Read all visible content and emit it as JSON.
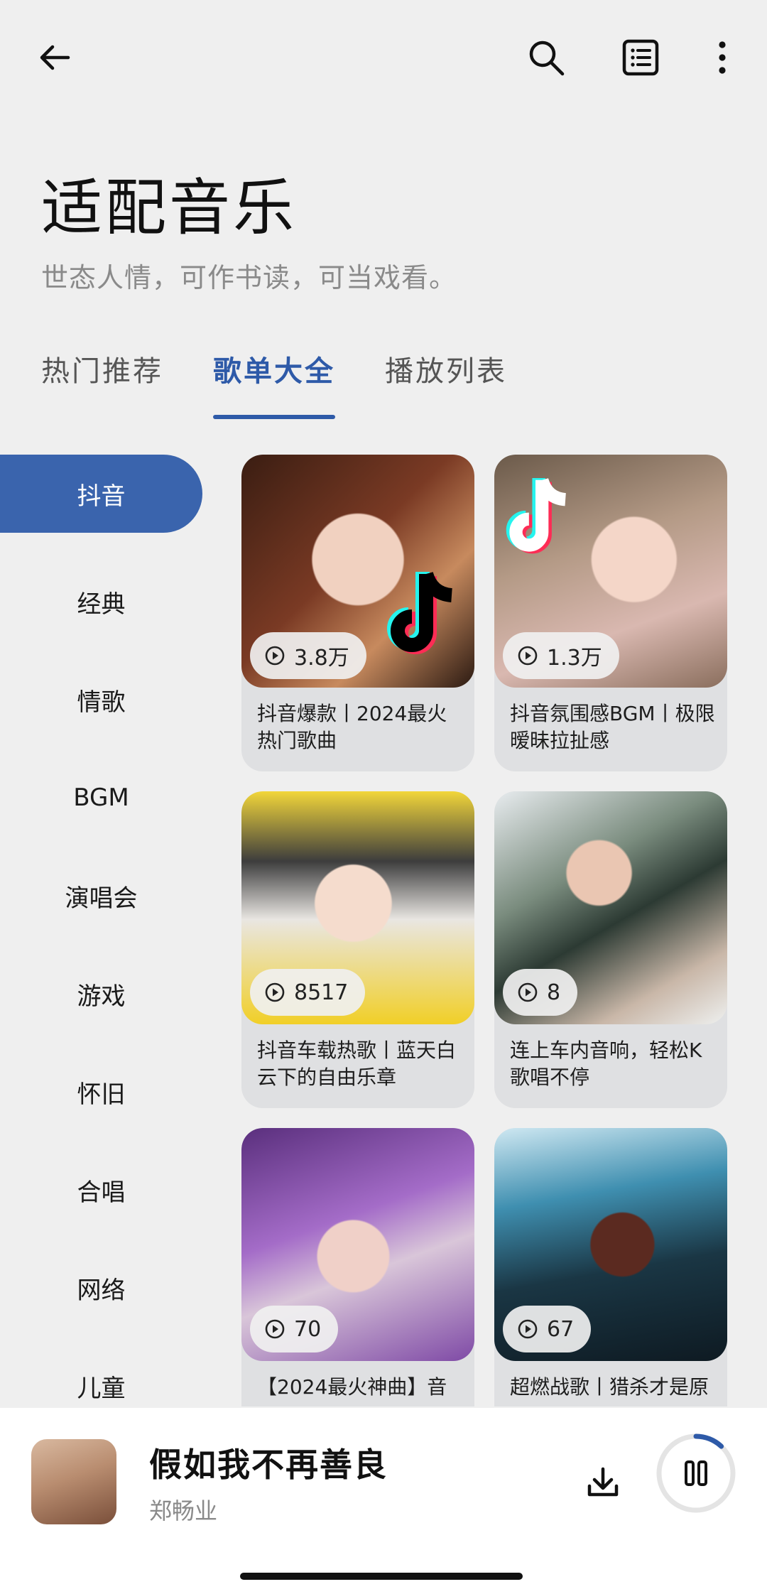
{
  "header": {
    "title": "适配音乐",
    "subtitle": "世态人情，可作书读，可当戏看。"
  },
  "tabs": [
    {
      "label": "热门推荐",
      "active": false
    },
    {
      "label": "歌单大全",
      "active": true
    },
    {
      "label": "播放列表",
      "active": false
    }
  ],
  "sidebar": {
    "items": [
      {
        "label": "抖音",
        "active": true
      },
      {
        "label": "经典"
      },
      {
        "label": "情歌"
      },
      {
        "label": "BGM"
      },
      {
        "label": "演唱会"
      },
      {
        "label": "游戏"
      },
      {
        "label": "怀旧"
      },
      {
        "label": "合唱"
      },
      {
        "label": "网络"
      },
      {
        "label": "儿童"
      }
    ]
  },
  "playlists": [
    {
      "plays": "3.8万",
      "title": "抖音爆款丨2024最火热门歌曲"
    },
    {
      "plays": "1.3万",
      "title": "抖音氛围感BGM丨极限暧昧拉扯感"
    },
    {
      "plays": "8517",
      "title": "抖音车载热歌丨蓝天白云下的自由乐章"
    },
    {
      "plays": "8",
      "title": "连上车内音响，轻松K歌唱不停"
    },
    {
      "plays": "70",
      "title": "【2024最火神曲】音"
    },
    {
      "plays": "67",
      "title": "超燃战歌丨猎杀才是原"
    }
  ],
  "player": {
    "song": "假如我不再善良",
    "artist": "郑畅业",
    "progress": 0.12
  },
  "colors": {
    "accent": "#2e5aa8",
    "sidebar_active": "#3a64ad",
    "background": "#efefef"
  }
}
